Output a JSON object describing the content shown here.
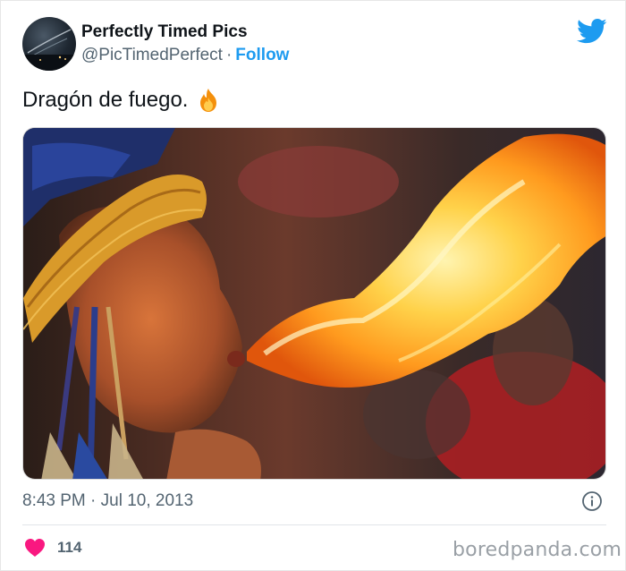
{
  "tweet": {
    "author": {
      "name": "Perfectly Timed Pics",
      "handle": "@PicTimedPerfect",
      "separator": "·",
      "follow_label": "Follow"
    },
    "text": "Dragón de fuego.",
    "emoji": "fire-emoji",
    "timestamp": "8:43 PM · Jul 10, 2013",
    "likes": "114"
  },
  "icons": {
    "brand": "twitter-bird-icon",
    "info": "info-icon",
    "like": "heart-icon"
  },
  "colors": {
    "accent": "#1d9bf0",
    "like": "#f91880",
    "text": "#0f1419",
    "muted": "#536471"
  },
  "watermark": "boredpanda.com"
}
